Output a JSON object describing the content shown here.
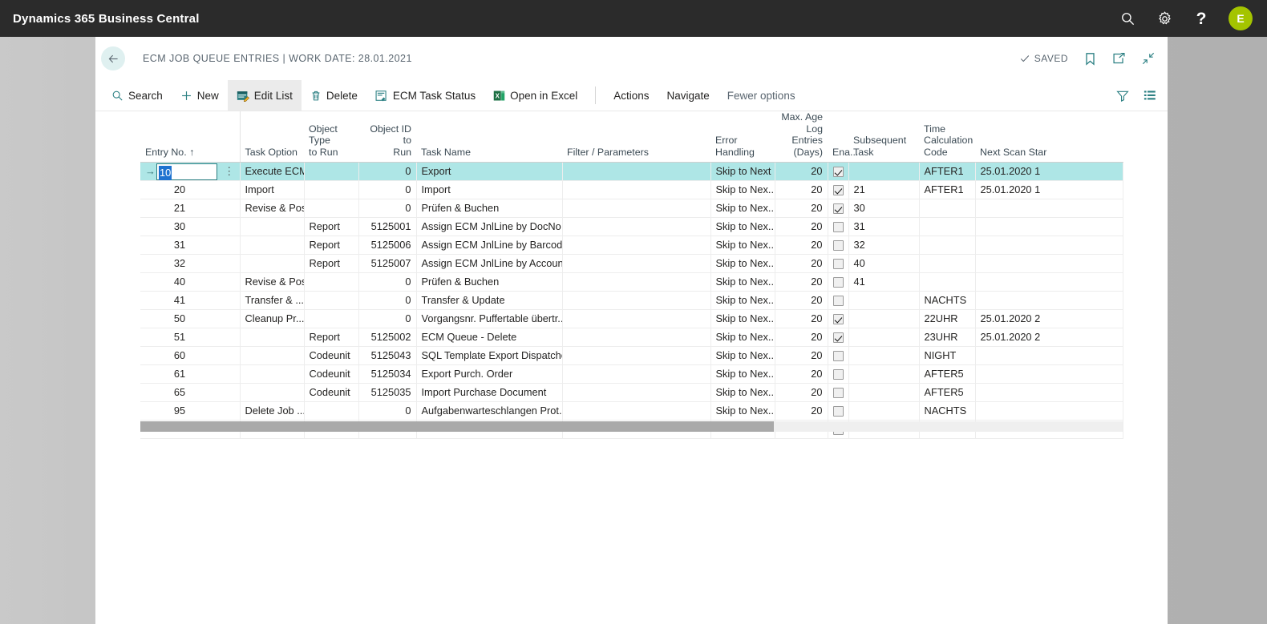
{
  "topbar": {
    "brand": "Dynamics 365 Business Central",
    "search_icon": "search-icon",
    "settings_icon": "gear-icon",
    "help_label": "?",
    "avatar_initial": "E"
  },
  "header": {
    "back_icon": "arrow-left-icon",
    "title": "ECM JOB QUEUE ENTRIES | WORK DATE: 28.01.2021",
    "saved_label": "SAVED",
    "bookmark_icon": "bookmark-icon",
    "open-new-window_icon": "open-in-new-window-icon",
    "collapse_icon": "collapse-icon"
  },
  "commandbar": {
    "items": [
      {
        "label": "Search",
        "icon": "search-icon",
        "active": false
      },
      {
        "label": "New",
        "icon": "plus-icon",
        "active": false
      },
      {
        "label": "Edit List",
        "icon": "edit-list-icon",
        "active": true
      },
      {
        "label": "Delete",
        "icon": "trash-icon",
        "active": false
      },
      {
        "label": "ECM Task Status",
        "icon": "task-status-icon",
        "active": false
      },
      {
        "label": "Open in Excel",
        "icon": "excel-icon",
        "active": false
      }
    ],
    "menus": [
      {
        "label": "Actions"
      },
      {
        "label": "Navigate"
      },
      {
        "label": "Fewer options"
      }
    ],
    "filter_icon": "filter-icon",
    "list_icon": "list-view-icon"
  },
  "grid": {
    "columns": [
      {
        "key": "entry_no",
        "label": "Entry No. ↑",
        "align": "left"
      },
      {
        "key": "rowmenu",
        "label": "",
        "align": "left"
      },
      {
        "key": "task_option",
        "label": "Task Option",
        "align": "left"
      },
      {
        "key": "object_type",
        "label": "Object Type\nto Run",
        "align": "left"
      },
      {
        "key": "object_id",
        "label": "Object ID to\nRun",
        "align": "right"
      },
      {
        "key": "task_name",
        "label": "Task Name",
        "align": "left"
      },
      {
        "key": "filter_params",
        "label": "Filter / Parameters",
        "align": "left"
      },
      {
        "key": "error_handling",
        "label": "Error\nHandling",
        "align": "left"
      },
      {
        "key": "max_age",
        "label": "Max. Age\nLog Entries\n(Days)",
        "align": "right"
      },
      {
        "key": "enabled",
        "label": "Ena...",
        "align": "center"
      },
      {
        "key": "subsequent",
        "label": "Subsequent\nTask",
        "align": "left"
      },
      {
        "key": "time_calc",
        "label": "Time\nCalculation\nCode",
        "align": "left"
      },
      {
        "key": "next_scan",
        "label": "Next Scan Star",
        "align": "left"
      }
    ],
    "rows": [
      {
        "selected": true,
        "entry_no": "10",
        "task_option": "Execute ECM",
        "object_type": "",
        "object_id": "0",
        "task_name": "Export",
        "filter_params": "",
        "error_handling": "Skip to Next F",
        "max_age": "20",
        "enabled": true,
        "subsequent": "",
        "time_calc": "AFTER1",
        "next_scan": "25.01.2020 1"
      },
      {
        "selected": false,
        "entry_no": "20",
        "task_option": "Import",
        "object_type": "",
        "object_id": "0",
        "task_name": "Import",
        "filter_params": "",
        "error_handling": "Skip to Nex...",
        "max_age": "20",
        "enabled": true,
        "subsequent": "21",
        "time_calc": "AFTER1",
        "next_scan": "25.01.2020 1"
      },
      {
        "selected": false,
        "entry_no": "21",
        "task_option": "Revise & Post",
        "object_type": "",
        "object_id": "0",
        "task_name": "Prüfen & Buchen",
        "filter_params": "",
        "error_handling": "Skip to Nex...",
        "max_age": "20",
        "enabled": true,
        "subsequent": "30",
        "time_calc": "",
        "next_scan": ""
      },
      {
        "selected": false,
        "entry_no": "30",
        "task_option": "",
        "object_type": "Report",
        "object_id": "5125001",
        "task_name": "Assign ECM JnlLine by DocNo",
        "filter_params": "",
        "error_handling": "Skip to Nex...",
        "max_age": "20",
        "enabled": false,
        "subsequent": "31",
        "time_calc": "",
        "next_scan": ""
      },
      {
        "selected": false,
        "entry_no": "31",
        "task_option": "",
        "object_type": "Report",
        "object_id": "5125006",
        "task_name": "Assign ECM JnlLine by Barcode",
        "filter_params": "",
        "error_handling": "Skip to Nex...",
        "max_age": "20",
        "enabled": false,
        "subsequent": "32",
        "time_calc": "",
        "next_scan": ""
      },
      {
        "selected": false,
        "entry_no": "32",
        "task_option": "",
        "object_type": "Report",
        "object_id": "5125007",
        "task_name": "Assign ECM JnlLine by Account",
        "filter_params": "",
        "error_handling": "Skip to Nex...",
        "max_age": "20",
        "enabled": false,
        "subsequent": "40",
        "time_calc": "",
        "next_scan": ""
      },
      {
        "selected": false,
        "entry_no": "40",
        "task_option": "Revise & Post",
        "object_type": "",
        "object_id": "0",
        "task_name": "Prüfen & Buchen",
        "filter_params": "",
        "error_handling": "Skip to Nex...",
        "max_age": "20",
        "enabled": false,
        "subsequent": "41",
        "time_calc": "",
        "next_scan": ""
      },
      {
        "selected": false,
        "entry_no": "41",
        "task_option": "Transfer & ...",
        "object_type": "",
        "object_id": "0",
        "task_name": "Transfer & Update",
        "filter_params": "",
        "error_handling": "Skip to Nex...",
        "max_age": "20",
        "enabled": false,
        "subsequent": "",
        "time_calc": "NACHTS",
        "next_scan": ""
      },
      {
        "selected": false,
        "entry_no": "50",
        "task_option": "Cleanup Pr...",
        "object_type": "",
        "object_id": "0",
        "task_name": "Vorgangsnr. Puffertable übertr...",
        "filter_params": "",
        "error_handling": "Skip to Nex...",
        "max_age": "20",
        "enabled": true,
        "subsequent": "",
        "time_calc": "22UHR",
        "next_scan": "25.01.2020 2"
      },
      {
        "selected": false,
        "entry_no": "51",
        "task_option": "",
        "object_type": "Report",
        "object_id": "5125002",
        "task_name": "ECM Queue - Delete",
        "filter_params": "",
        "error_handling": "Skip to Nex...",
        "max_age": "20",
        "enabled": true,
        "subsequent": "",
        "time_calc": "23UHR",
        "next_scan": "25.01.2020 2"
      },
      {
        "selected": false,
        "entry_no": "60",
        "task_option": "",
        "object_type": "Codeunit",
        "object_id": "5125043",
        "task_name": "SQL Template Export Dispatcher",
        "filter_params": "",
        "error_handling": "Skip to Nex...",
        "max_age": "20",
        "enabled": false,
        "subsequent": "",
        "time_calc": "NIGHT",
        "next_scan": ""
      },
      {
        "selected": false,
        "entry_no": "61",
        "task_option": "",
        "object_type": "Codeunit",
        "object_id": "5125034",
        "task_name": "Export Purch. Order",
        "filter_params": "",
        "error_handling": "Skip to Nex...",
        "max_age": "20",
        "enabled": false,
        "subsequent": "",
        "time_calc": "AFTER5",
        "next_scan": ""
      },
      {
        "selected": false,
        "entry_no": "65",
        "task_option": "",
        "object_type": "Codeunit",
        "object_id": "5125035",
        "task_name": "Import Purchase Document",
        "filter_params": "",
        "error_handling": "Skip to Nex...",
        "max_age": "20",
        "enabled": false,
        "subsequent": "",
        "time_calc": "AFTER5",
        "next_scan": ""
      },
      {
        "selected": false,
        "entry_no": "95",
        "task_option": "Delete Job ...",
        "object_type": "",
        "object_id": "0",
        "task_name": "Aufgabenwarteschlangen Prot...",
        "filter_params": "",
        "error_handling": "Skip to Nex...",
        "max_age": "20",
        "enabled": false,
        "subsequent": "",
        "time_calc": "NACHTS",
        "next_scan": ""
      },
      {
        "selected": false,
        "entry_no": "",
        "task_option": "",
        "object_type": "",
        "object_id": "",
        "task_name": "",
        "filter_params": "",
        "error_handling": "",
        "max_age": "",
        "enabled": false,
        "subsequent": "",
        "time_calc": "",
        "next_scan": ""
      }
    ]
  },
  "colors": {
    "brand_bar": "#2b2b2b",
    "accent_teal": "#2a7f82",
    "selected_row": "#aee6e6",
    "avatar_green": "#a4c400",
    "selection_blue": "#1e72d0"
  }
}
